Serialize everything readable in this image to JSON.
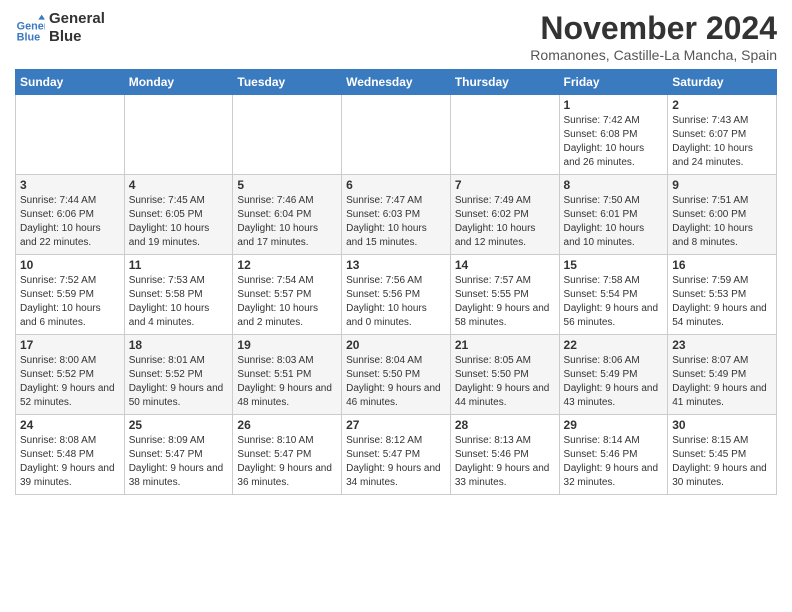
{
  "header": {
    "logo_line1": "General",
    "logo_line2": "Blue",
    "month": "November 2024",
    "location": "Romanones, Castille-La Mancha, Spain"
  },
  "weekdays": [
    "Sunday",
    "Monday",
    "Tuesday",
    "Wednesday",
    "Thursday",
    "Friday",
    "Saturday"
  ],
  "weeks": [
    [
      {
        "day": "",
        "info": ""
      },
      {
        "day": "",
        "info": ""
      },
      {
        "day": "",
        "info": ""
      },
      {
        "day": "",
        "info": ""
      },
      {
        "day": "",
        "info": ""
      },
      {
        "day": "1",
        "info": "Sunrise: 7:42 AM\nSunset: 6:08 PM\nDaylight: 10 hours and 26 minutes."
      },
      {
        "day": "2",
        "info": "Sunrise: 7:43 AM\nSunset: 6:07 PM\nDaylight: 10 hours and 24 minutes."
      }
    ],
    [
      {
        "day": "3",
        "info": "Sunrise: 7:44 AM\nSunset: 6:06 PM\nDaylight: 10 hours and 22 minutes."
      },
      {
        "day": "4",
        "info": "Sunrise: 7:45 AM\nSunset: 6:05 PM\nDaylight: 10 hours and 19 minutes."
      },
      {
        "day": "5",
        "info": "Sunrise: 7:46 AM\nSunset: 6:04 PM\nDaylight: 10 hours and 17 minutes."
      },
      {
        "day": "6",
        "info": "Sunrise: 7:47 AM\nSunset: 6:03 PM\nDaylight: 10 hours and 15 minutes."
      },
      {
        "day": "7",
        "info": "Sunrise: 7:49 AM\nSunset: 6:02 PM\nDaylight: 10 hours and 12 minutes."
      },
      {
        "day": "8",
        "info": "Sunrise: 7:50 AM\nSunset: 6:01 PM\nDaylight: 10 hours and 10 minutes."
      },
      {
        "day": "9",
        "info": "Sunrise: 7:51 AM\nSunset: 6:00 PM\nDaylight: 10 hours and 8 minutes."
      }
    ],
    [
      {
        "day": "10",
        "info": "Sunrise: 7:52 AM\nSunset: 5:59 PM\nDaylight: 10 hours and 6 minutes."
      },
      {
        "day": "11",
        "info": "Sunrise: 7:53 AM\nSunset: 5:58 PM\nDaylight: 10 hours and 4 minutes."
      },
      {
        "day": "12",
        "info": "Sunrise: 7:54 AM\nSunset: 5:57 PM\nDaylight: 10 hours and 2 minutes."
      },
      {
        "day": "13",
        "info": "Sunrise: 7:56 AM\nSunset: 5:56 PM\nDaylight: 10 hours and 0 minutes."
      },
      {
        "day": "14",
        "info": "Sunrise: 7:57 AM\nSunset: 5:55 PM\nDaylight: 9 hours and 58 minutes."
      },
      {
        "day": "15",
        "info": "Sunrise: 7:58 AM\nSunset: 5:54 PM\nDaylight: 9 hours and 56 minutes."
      },
      {
        "day": "16",
        "info": "Sunrise: 7:59 AM\nSunset: 5:53 PM\nDaylight: 9 hours and 54 minutes."
      }
    ],
    [
      {
        "day": "17",
        "info": "Sunrise: 8:00 AM\nSunset: 5:52 PM\nDaylight: 9 hours and 52 minutes."
      },
      {
        "day": "18",
        "info": "Sunrise: 8:01 AM\nSunset: 5:52 PM\nDaylight: 9 hours and 50 minutes."
      },
      {
        "day": "19",
        "info": "Sunrise: 8:03 AM\nSunset: 5:51 PM\nDaylight: 9 hours and 48 minutes."
      },
      {
        "day": "20",
        "info": "Sunrise: 8:04 AM\nSunset: 5:50 PM\nDaylight: 9 hours and 46 minutes."
      },
      {
        "day": "21",
        "info": "Sunrise: 8:05 AM\nSunset: 5:50 PM\nDaylight: 9 hours and 44 minutes."
      },
      {
        "day": "22",
        "info": "Sunrise: 8:06 AM\nSunset: 5:49 PM\nDaylight: 9 hours and 43 minutes."
      },
      {
        "day": "23",
        "info": "Sunrise: 8:07 AM\nSunset: 5:49 PM\nDaylight: 9 hours and 41 minutes."
      }
    ],
    [
      {
        "day": "24",
        "info": "Sunrise: 8:08 AM\nSunset: 5:48 PM\nDaylight: 9 hours and 39 minutes."
      },
      {
        "day": "25",
        "info": "Sunrise: 8:09 AM\nSunset: 5:47 PM\nDaylight: 9 hours and 38 minutes."
      },
      {
        "day": "26",
        "info": "Sunrise: 8:10 AM\nSunset: 5:47 PM\nDaylight: 9 hours and 36 minutes."
      },
      {
        "day": "27",
        "info": "Sunrise: 8:12 AM\nSunset: 5:47 PM\nDaylight: 9 hours and 34 minutes."
      },
      {
        "day": "28",
        "info": "Sunrise: 8:13 AM\nSunset: 5:46 PM\nDaylight: 9 hours and 33 minutes."
      },
      {
        "day": "29",
        "info": "Sunrise: 8:14 AM\nSunset: 5:46 PM\nDaylight: 9 hours and 32 minutes."
      },
      {
        "day": "30",
        "info": "Sunrise: 8:15 AM\nSunset: 5:45 PM\nDaylight: 9 hours and 30 minutes."
      }
    ]
  ]
}
